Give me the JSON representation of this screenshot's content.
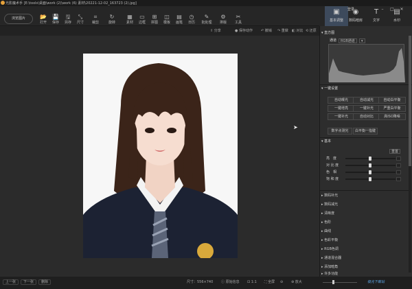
{
  "app": {
    "title": "光影魔术手 [E:\\tools\\桌面\\work (2)\\work (6) 素材\\20221-12-02_163723 (2).jpg]",
    "login": "登录"
  },
  "toolbar": {
    "browse_label": "浏览图片",
    "tools": [
      {
        "icon": "📂",
        "label": "打开"
      },
      {
        "icon": "💾",
        "label": "保存"
      },
      {
        "icon": "🖫",
        "label": "另存"
      },
      {
        "icon": "⤡",
        "label": "尺寸"
      },
      {
        "icon": "⌗",
        "label": "裁剪"
      },
      {
        "icon": "↻",
        "label": "旋转"
      },
      {
        "icon": "▦",
        "label": "素材"
      },
      {
        "icon": "▭",
        "label": "边框"
      },
      {
        "icon": "⊞",
        "label": "拼图"
      },
      {
        "icon": "◫",
        "label": "模板"
      },
      {
        "icon": "▤",
        "label": "画笔"
      },
      {
        "icon": "◷",
        "label": "日历"
      },
      {
        "icon": "✎",
        "label": "批处理"
      },
      {
        "icon": "⚙",
        "label": "排版"
      },
      {
        "icon": "✂",
        "label": "工具"
      }
    ]
  },
  "right_tabs": [
    {
      "icon": "▣",
      "label": "基本调整"
    },
    {
      "icon": "◉",
      "label": "数码暗房"
    },
    {
      "icon": "T",
      "label": "文字"
    },
    {
      "icon": "▤",
      "label": "水印"
    }
  ],
  "subbar": {
    "share": "分享",
    "save_as_file": "保存动作",
    "undo": "撤销",
    "redo": "重做",
    "compare": "对比",
    "restore": "还原"
  },
  "panel": {
    "histogram_title": "直方图",
    "channel_label": "通道",
    "channel_value": "RGB通道",
    "oneclick_title": "一键设置",
    "buttons": [
      [
        "自动曝光",
        "自动减光",
        "自动白平衡"
      ],
      [
        "一键增亮",
        "一键补光",
        "严重白平衡"
      ],
      [
        "一键补光",
        "自动对比",
        "高ISO降噪"
      ]
    ],
    "extra_buttons": [
      "数字点测光",
      "白平衡一指键"
    ],
    "basic_title": "基本",
    "reset": "重置",
    "sliders": [
      {
        "label": "亮　度",
        "value": 0.5
      },
      {
        "label": "对 比 度",
        "value": 0.5
      },
      {
        "label": "色　相",
        "value": 0.5
      },
      {
        "label": "饱 和 度",
        "value": 0.5
      }
    ],
    "sections": [
      "数码补光",
      "数码减光",
      "清晰度",
      "色阶",
      "曲线",
      "色彩平衡",
      "RGB色调",
      "通道混合器",
      "添加暗角",
      "许多功能"
    ]
  },
  "status": {
    "prev": "上一张",
    "next": "下一张",
    "delete": "删除",
    "size": "尺寸：556×740",
    "original": "原始信息",
    "fit": "1:1",
    "fullscreen": "全屏",
    "zoom_in": "放大",
    "zoom_out": "缩小"
  },
  "watermark": "极光下载站"
}
